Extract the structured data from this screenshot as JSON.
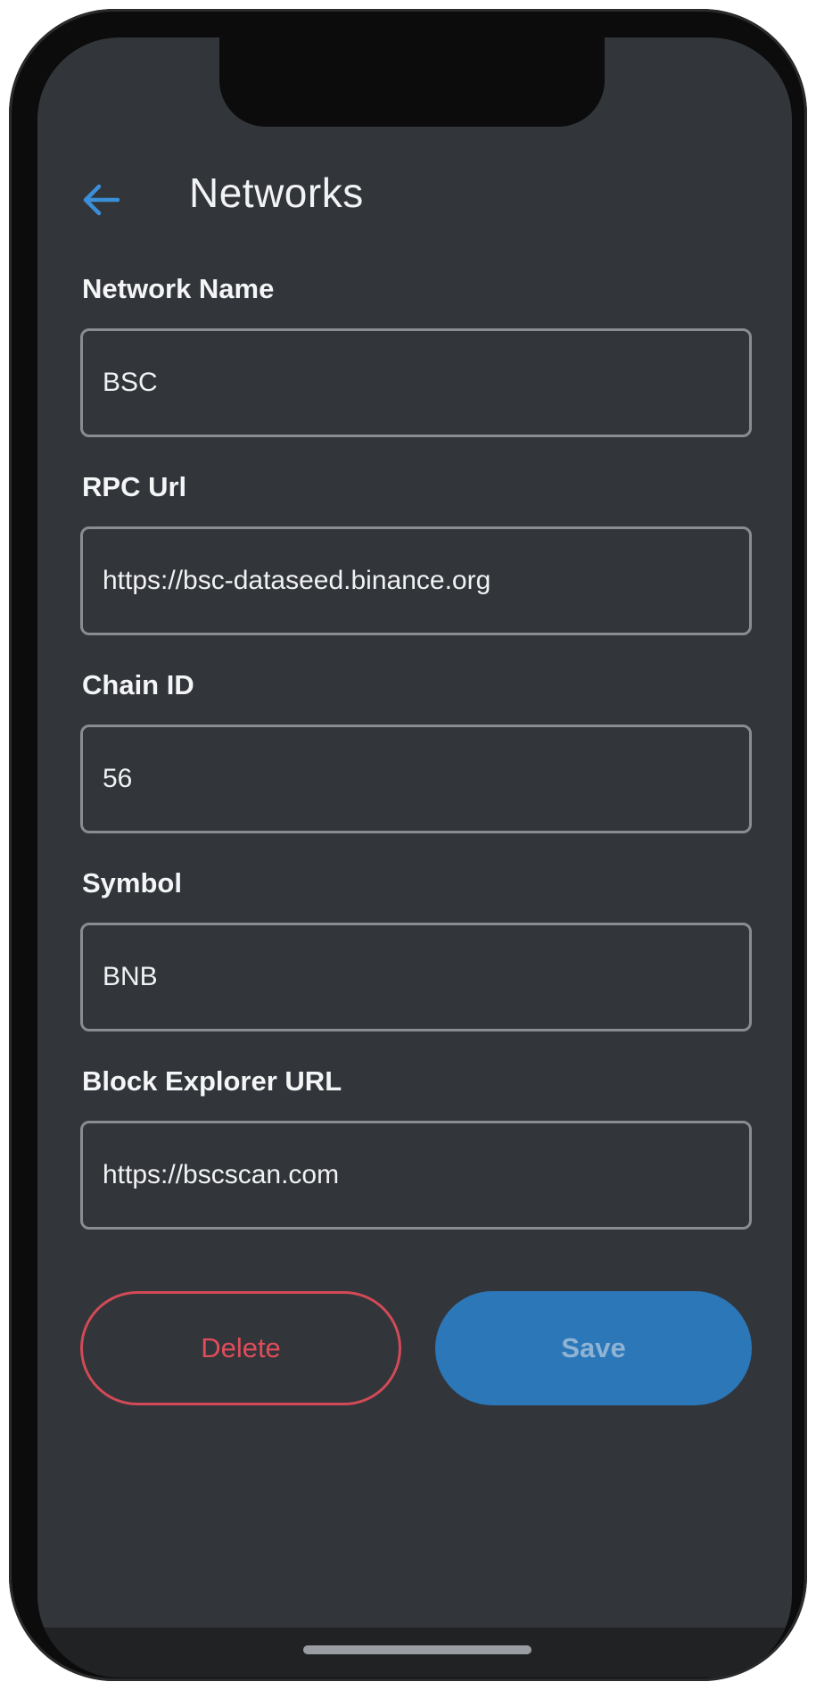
{
  "header": {
    "title": "Networks",
    "back_icon": "arrow-left-icon",
    "back_icon_color": "#3b8fd9"
  },
  "form": {
    "fields": [
      {
        "label": "Network Name",
        "value": "BSC"
      },
      {
        "label": "RPC Url",
        "value": "https://bsc-dataseed.binance.org"
      },
      {
        "label": "Chain ID",
        "value": "56"
      },
      {
        "label": "Symbol",
        "value": "BNB"
      },
      {
        "label": "Block Explorer URL",
        "value": "https://bscscan.com"
      }
    ]
  },
  "actions": {
    "delete_label": "Delete",
    "save_label": "Save",
    "delete_color": "#e04c5a",
    "save_color": "#2b77b8"
  },
  "theme": {
    "background": "#323539",
    "text": "#f2f3f5",
    "input_border": "#8a8d90"
  }
}
